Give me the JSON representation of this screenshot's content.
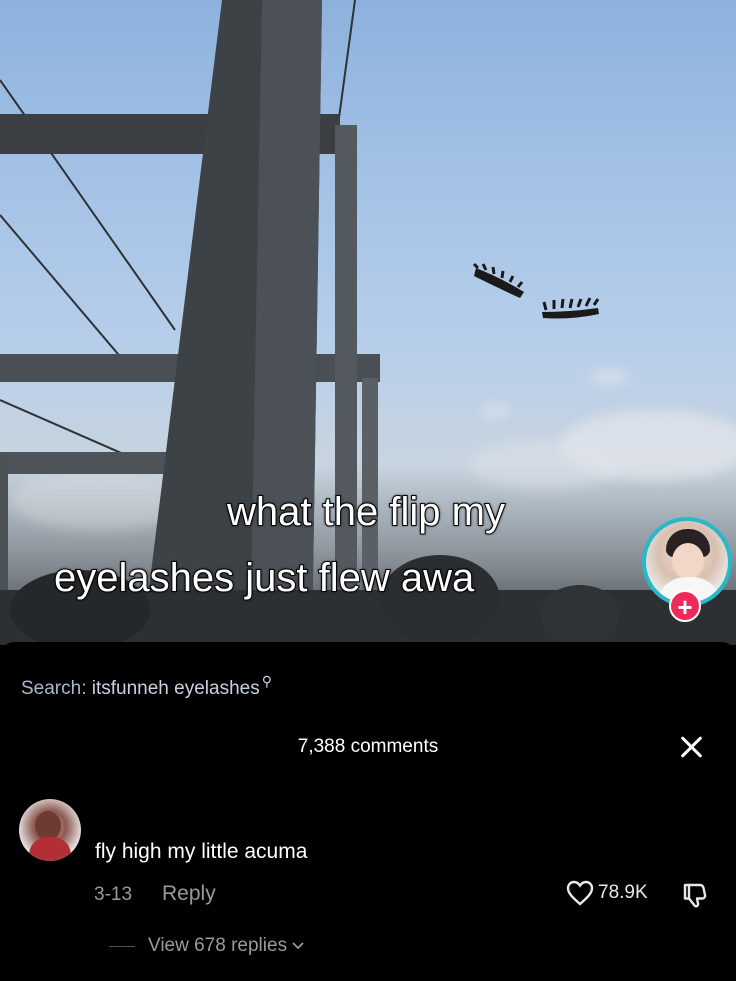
{
  "video": {
    "caption_line1": "what the flip my",
    "caption_line2": "eyelashes just flew awa"
  },
  "sheet": {
    "search_prefix": "Search:",
    "search_term": "itsfunneh eyelashes",
    "comment_count": "7,388 comments"
  },
  "comment": {
    "text": "fly high my little acuma",
    "date": "3-13",
    "reply_label": "Reply",
    "likes": "78.9K",
    "view_replies": "View 678 replies"
  },
  "colors": {
    "accent_ring": "#2ab7c8",
    "follow_plus": "#ee2a5a",
    "muted_text": "#9a9a9a"
  }
}
